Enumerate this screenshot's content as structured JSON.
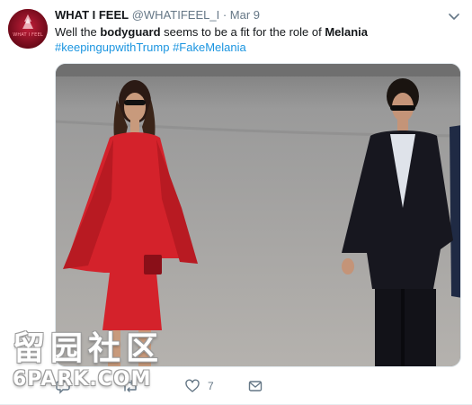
{
  "tweet": {
    "author_name": "WHAT I FEEL",
    "handle": "@WHATIFEEL_I",
    "separator": "·",
    "date": "Mar 9",
    "text": {
      "part1": "Well the ",
      "bold1": "bodyguard",
      "part2": " seems to be a fit for the role of ",
      "bold2": "Melania"
    },
    "hashtags": [
      "#keepingupwithTrump",
      "#FakeMelania"
    ],
    "avatar_text": "WHAT I FEEL",
    "avatar_color": "#8b1023",
    "link_color": "#1b95e0",
    "media_alt_icon": "photo",
    "more_icon": "chevron-down-icon"
  },
  "actions": {
    "reply_icon": "reply-icon",
    "retweet_icon": "retweet-icon",
    "like_icon": "heart-icon",
    "like_count": "7",
    "message_icon": "envelope-icon"
  },
  "watermark": {
    "cn": "留园社区",
    "en": "6PARK.COM"
  }
}
